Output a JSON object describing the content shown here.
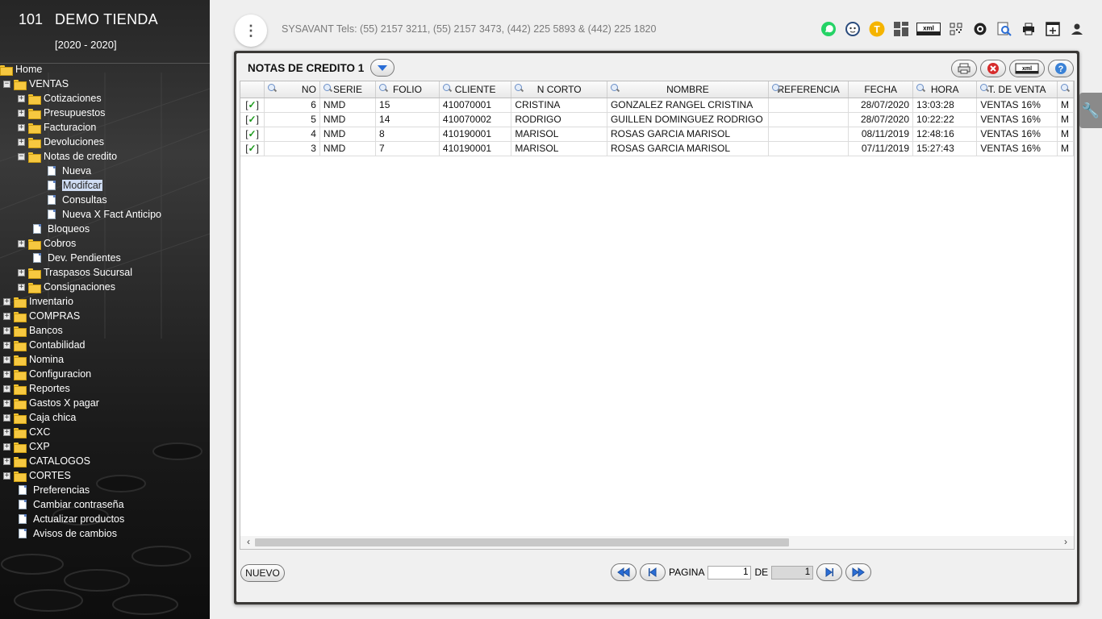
{
  "brand": {
    "code": "101",
    "name": "DEMO TIENDA",
    "years": "[2020 - 2020]"
  },
  "tree": [
    {
      "label": "Home",
      "level": 0,
      "type": "folder",
      "pm": "",
      "name": "tree-home"
    },
    {
      "label": "VENTAS",
      "level": 1,
      "type": "folder",
      "pm": "−",
      "name": "tree-ventas"
    },
    {
      "label": "Cotizaciones",
      "level": 2,
      "type": "folder",
      "pm": "+",
      "name": "tree-cotizaciones"
    },
    {
      "label": "Presupuestos",
      "level": 2,
      "type": "folder",
      "pm": "+",
      "name": "tree-presupuestos"
    },
    {
      "label": "Facturacion",
      "level": 2,
      "type": "folder",
      "pm": "+",
      "name": "tree-facturacion"
    },
    {
      "label": "Devoluciones",
      "level": 2,
      "type": "folder",
      "pm": "+",
      "name": "tree-devoluciones"
    },
    {
      "label": "Notas de credito",
      "level": 2,
      "type": "folder",
      "pm": "−",
      "name": "tree-notas-de-credito"
    },
    {
      "label": "Nueva",
      "level": 3,
      "type": "doc",
      "pm": "",
      "name": "tree-nueva"
    },
    {
      "label": "Modifcar",
      "level": 3,
      "type": "doc",
      "pm": "",
      "name": "tree-modificar",
      "selected": true
    },
    {
      "label": "Consultas",
      "level": 3,
      "type": "doc",
      "pm": "",
      "name": "tree-consultas"
    },
    {
      "label": "Nueva X Fact Anticipo",
      "level": 3,
      "type": "doc",
      "pm": "",
      "name": "tree-nueva-x-fact-anticipo"
    },
    {
      "label": "Bloqueos",
      "level": 2,
      "type": "doc",
      "pm": "",
      "name": "tree-bloqueos"
    },
    {
      "label": "Cobros",
      "level": 2,
      "type": "folder",
      "pm": "+",
      "name": "tree-cobros"
    },
    {
      "label": "Dev. Pendientes",
      "level": 2,
      "type": "doc",
      "pm": "",
      "name": "tree-dev-pendientes"
    },
    {
      "label": "Traspasos Sucursal",
      "level": 2,
      "type": "folder",
      "pm": "+",
      "name": "tree-traspasos-sucursal"
    },
    {
      "label": "Consignaciones",
      "level": 2,
      "type": "folder",
      "pm": "+",
      "name": "tree-consignaciones"
    },
    {
      "label": "Inventario",
      "level": 1,
      "type": "folder",
      "pm": "+",
      "name": "tree-inventario"
    },
    {
      "label": "COMPRAS",
      "level": 1,
      "type": "folder",
      "pm": "+",
      "name": "tree-compras"
    },
    {
      "label": "Bancos",
      "level": 1,
      "type": "folder",
      "pm": "+",
      "name": "tree-bancos"
    },
    {
      "label": "Contabilidad",
      "level": 1,
      "type": "folder",
      "pm": "+",
      "name": "tree-contabilidad"
    },
    {
      "label": "Nomina",
      "level": 1,
      "type": "folder",
      "pm": "+",
      "name": "tree-nomina"
    },
    {
      "label": "Configuracion",
      "level": 1,
      "type": "folder",
      "pm": "+",
      "name": "tree-configuracion"
    },
    {
      "label": "Reportes",
      "level": 1,
      "type": "folder",
      "pm": "+",
      "name": "tree-reportes"
    },
    {
      "label": "Gastos X pagar",
      "level": 1,
      "type": "folder",
      "pm": "+",
      "name": "tree-gastos-x-pagar"
    },
    {
      "label": "Caja chica",
      "level": 1,
      "type": "folder",
      "pm": "+",
      "name": "tree-caja-chica"
    },
    {
      "label": "CXC",
      "level": 1,
      "type": "folder",
      "pm": "+",
      "name": "tree-cxc"
    },
    {
      "label": "CXP",
      "level": 1,
      "type": "folder",
      "pm": "+",
      "name": "tree-cxp"
    },
    {
      "label": "CATALOGOS",
      "level": 1,
      "type": "folder",
      "pm": "+",
      "name": "tree-catalogos"
    },
    {
      "label": "CORTES",
      "level": 1,
      "type": "folder",
      "pm": "+",
      "name": "tree-cortes"
    },
    {
      "label": "Preferencias",
      "level": 1,
      "type": "doc",
      "pm": "",
      "name": "tree-preferencias"
    },
    {
      "label": "Cambiar contraseña",
      "level": 1,
      "type": "doc",
      "pm": "",
      "name": "tree-cambiar-contrasena"
    },
    {
      "label": "Actualizar productos",
      "level": 1,
      "type": "doc",
      "pm": "",
      "name": "tree-actualizar-productos"
    },
    {
      "label": "Avisos de cambios",
      "level": 1,
      "type": "doc",
      "pm": "",
      "name": "tree-avisos-de-cambios"
    }
  ],
  "topbar": {
    "contact": "SYSAVANT Tels: (55) 2157 3211, (55) 2157 3473, (442) 225 5893 & (442) 225 1820",
    "icons": [
      {
        "name": "whatsapp-icon",
        "glyph": "✆",
        "color": "#25d366"
      },
      {
        "name": "support-icon",
        "glyph": "☺",
        "color": "#2a4b7c"
      },
      {
        "name": "t-badge-icon",
        "glyph": "T",
        "color": "#f5b400"
      },
      {
        "name": "dashboard-icon",
        "glyph": "▦",
        "color": "#444"
      },
      {
        "name": "xml-icon",
        "glyph": "xml",
        "color": "#222"
      },
      {
        "name": "qr-icon",
        "glyph": "▩",
        "color": "#333"
      },
      {
        "name": "settings-icon",
        "glyph": "◎",
        "color": "#222"
      },
      {
        "name": "search-document-icon",
        "glyph": "⌕",
        "color": "#2a6dd6"
      },
      {
        "name": "printer-icon",
        "glyph": "⎙",
        "color": "#222"
      },
      {
        "name": "window-add-icon",
        "glyph": "⊞",
        "color": "#222"
      },
      {
        "name": "user-icon",
        "glyph": "●",
        "color": "#333"
      }
    ]
  },
  "panel": {
    "title": "NOTAS DE CREDITO 1",
    "columns": [
      "",
      "NO",
      "SERIE",
      "FOLIO",
      "CLIENTE",
      "N CORTO",
      "NOMBRE",
      "REFERENCIA",
      "FECHA",
      "HORA",
      "T. DE VENTA",
      ""
    ],
    "rows": [
      {
        "chk": "[✓]",
        "no": "6",
        "serie": "NMD",
        "folio": "15",
        "cliente": "410070001",
        "ncorto": "CRISTINA",
        "nombre": "GONZALEZ RANGEL CRISTINA",
        "referencia": "",
        "fecha": "28/07/2020",
        "hora": "13:03:28",
        "tventa": "VENTAS 16%",
        "extra": "M"
      },
      {
        "chk": "[✓]",
        "no": "5",
        "serie": "NMD",
        "folio": "14",
        "cliente": "410070002",
        "ncorto": "RODRIGO",
        "nombre": "GUILLEN DOMINGUEZ RODRIGO",
        "referencia": "",
        "fecha": "28/07/2020",
        "hora": "10:22:22",
        "tventa": "VENTAS 16%",
        "extra": "M"
      },
      {
        "chk": "[✓]",
        "no": "4",
        "serie": "NMD",
        "folio": "8",
        "cliente": "410190001",
        "ncorto": "MARISOL",
        "nombre": "ROSAS GARCIA MARISOL",
        "referencia": "",
        "fecha": "08/11/2019",
        "hora": "12:48:16",
        "tventa": "VENTAS 16%",
        "extra": "M"
      },
      {
        "chk": "[✓]",
        "no": "3",
        "serie": "NMD",
        "folio": "7",
        "cliente": "410190001",
        "ncorto": "MARISOL",
        "nombre": "ROSAS GARCIA MARISOL",
        "referencia": "",
        "fecha": "07/11/2019",
        "hora": "15:27:43",
        "tventa": "VENTAS 16%",
        "extra": "M"
      }
    ],
    "nuevo_label": "NUEVO",
    "pager": {
      "pagina_label": "PAGINA",
      "page": "1",
      "de_label": "DE",
      "total": "1"
    },
    "xml_label": "xml"
  }
}
